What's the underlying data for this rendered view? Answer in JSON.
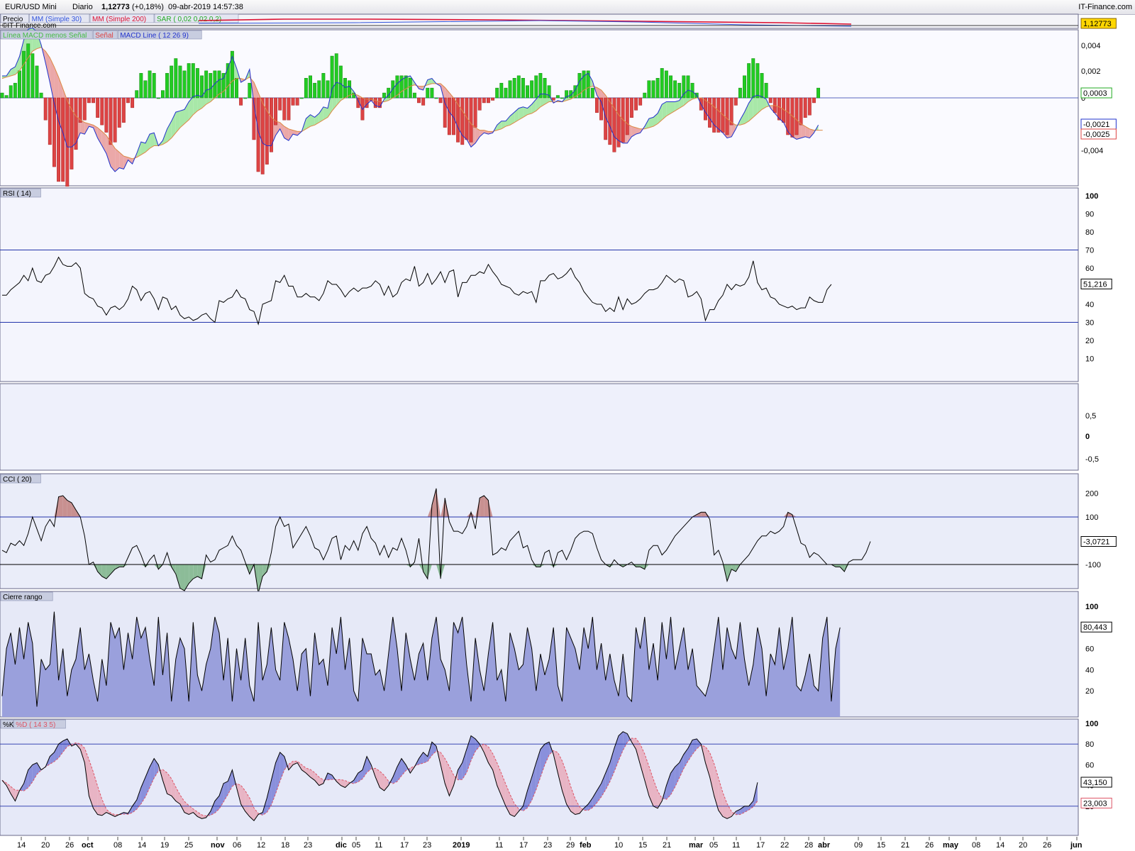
{
  "header": {
    "instrument": "EUR/USD Mini",
    "period": "Diario",
    "price": "1,12773",
    "change": "(+0,18%)",
    "datetime": "09-abr-2019 14:57:38",
    "brand": "IT-Finance.com"
  },
  "price_panel": {
    "legend": [
      {
        "text": "Precio",
        "color": "#000000"
      },
      {
        "text": "MM (Simple 30)",
        "color": "#3355dd"
      },
      {
        "text": "MM (Simple 200)",
        "color": "#dd1133"
      },
      {
        "text": "SAR ( 0,02 0,02 0,2)",
        "color": "#22aa22"
      }
    ],
    "watermark": "©IT-Finance.com",
    "last_value": "1,12773"
  },
  "colors": {
    "panel_bg": "#eef0fa",
    "grid_line": "#2233aa",
    "hist_pos": "#22cc22",
    "hist_neg": "#dd4444",
    "fill_pos": "#a8e8a8",
    "fill_neg": "#eba8a8",
    "cr_fill": "#9aa0dc",
    "k_fill_up": "#8a90dc",
    "k_fill_down": "#e8b4c4",
    "cci_fill_up": "#c89090",
    "cci_fill_down": "#8cbc98"
  },
  "chart_data": [
    {
      "type": "line",
      "title": "MACD",
      "legend": [
        "Línea MACD menos Señal",
        "Señal",
        "MACD Line ( 12 26 9)"
      ],
      "y_ticks": [
        "0,004",
        "0,002",
        "0",
        "-0,002",
        "-0,004"
      ],
      "last_values": {
        "histogram": "0,0003",
        "macd": "-0,0021",
        "signal": "-0,0025"
      },
      "macd": [
        0.0017,
        0.0017,
        0.0022,
        0.0024,
        0.0032,
        0.0045,
        0.0053,
        0.0054,
        0.0051,
        0.0041,
        0.0027,
        0.0012,
        -0.0004,
        -0.0018,
        -0.0027,
        -0.0038,
        -0.0038,
        -0.0035,
        -0.0027,
        -0.0028,
        -0.0022,
        -0.0023,
        -0.0031,
        -0.0037,
        -0.0043,
        -0.0053,
        -0.0057,
        -0.0054,
        -0.0055,
        -0.0048,
        -0.0051,
        -0.0043,
        -0.0034,
        -0.0035,
        -0.0028,
        -0.0027,
        -0.0037,
        -0.0033,
        -0.0024,
        -0.0018,
        -0.0011,
        -0.001,
        -0.0009,
        -0.0003,
        0.0001,
        0.0002,
        0.0001,
        0.0006,
        0.0007,
        0.0011,
        0.0014,
        0.0015,
        0.0023,
        0.0032,
        0.0023,
        0.0012,
        0.0014,
        0.0022,
        -0.0005,
        -0.0026,
        -0.0035,
        -0.0037,
        -0.0037,
        -0.0029,
        -0.0024,
        -0.0031,
        -0.0033,
        -0.0028,
        -0.0029,
        -0.0026,
        -0.0016,
        -0.0013,
        -0.0015,
        -0.0012,
        -0.0007,
        -0.0008,
        0.0007,
        0.0012,
        0.0011,
        0.0008,
        0.0009,
        0.0005,
        -0.0002,
        -0.0009,
        -0.0005,
        -0.0002,
        -0.0006,
        -0.0007,
        -0.0001,
        0.0002,
        0.0007,
        0.0011,
        0.0014,
        0.0016,
        0.0017,
        0.0012,
        0.0007,
        0.0006,
        0.0014,
        0.0015,
        0.0011,
        0.0009,
        -0.0004,
        -0.0011,
        -0.0015,
        -0.0023,
        -0.0029,
        -0.0032,
        -0.0038,
        -0.0035,
        -0.003,
        -0.0027,
        -0.0028,
        -0.0027,
        -0.0021,
        -0.0018,
        -0.0018,
        -0.0014,
        -0.0011,
        -0.0008,
        -0.0007,
        -0.0008,
        -0.0005,
        -0.0001,
        0.0003,
        0.0003,
        0.0002,
        -0.0004,
        -0.0002,
        -0.0003,
        0.0001,
        0.0002,
        0.0006,
        0.0013,
        0.0017,
        0.0019,
        0.0013,
        0.0002,
        -0.0003,
        -0.0015,
        -0.0022,
        -0.003,
        -0.0033,
        -0.0035,
        -0.0035,
        -0.003,
        -0.0028,
        -0.0027,
        -0.0022,
        -0.0016,
        -0.0015,
        -0.0012,
        -0.0005,
        -0.0003,
        -0.0003,
        -0.0003,
        -0.0002,
        0.0003,
        0.0006,
        0.0005,
        0.0002,
        -0.0005,
        -0.0011,
        -0.0016,
        -0.0021,
        -0.0024,
        -0.0027,
        -0.0031,
        -0.003,
        -0.0024,
        -0.0017,
        -0.0011,
        -0.0004,
        0.0001,
        0.0002,
        0.0001,
        -0.0001,
        -0.0008,
        -0.0012,
        -0.0016,
        -0.0019,
        -0.0026,
        -0.003,
        -0.0032,
        -0.0031,
        -0.003,
        -0.0031,
        -0.0027,
        -0.0021
      ],
      "signal": [
        0.0015,
        0.0016,
        0.0017,
        0.0018,
        0.0021,
        0.0026,
        0.0031,
        0.0036,
        0.0038,
        0.0039,
        0.0036,
        0.0031,
        0.0024,
        0.0016,
        0.0007,
        -0.0002,
        -0.0009,
        -0.0014,
        -0.0017,
        -0.0019,
        -0.002,
        -0.0021,
        -0.0023,
        -0.0026,
        -0.0029,
        -0.0034,
        -0.0039,
        -0.0042,
        -0.0045,
        -0.0046,
        -0.0047,
        -0.0046,
        -0.0044,
        -0.0042,
        -0.0039,
        -0.0037,
        -0.0037,
        -0.0036,
        -0.0034,
        -0.0031,
        -0.0027,
        -0.0023,
        -0.002,
        -0.0017,
        -0.0013,
        -0.001,
        -0.0008,
        -0.0005,
        -0.0003,
        -0.0,
        0.0003,
        0.0005,
        0.0009,
        0.0013,
        0.0015,
        0.0015,
        0.0014,
        0.0016,
        0.0012,
        0.0004,
        -0.0004,
        -0.001,
        -0.0015,
        -0.0018,
        -0.0019,
        -0.0022,
        -0.0024,
        -0.0025,
        -0.0026,
        -0.0026,
        -0.0024,
        -0.0022,
        -0.0021,
        -0.0019,
        -0.0017,
        -0.0015,
        -0.001,
        -0.0006,
        -0.0002,
        0.0,
        0.0002,
        0.0003,
        0.0002,
        0.0,
        -0.0001,
        -0.0001,
        -0.0002,
        -0.0003,
        -0.0003,
        -0.0002,
        0.0,
        0.0002,
        0.0005,
        0.0007,
        0.0009,
        0.001,
        0.0009,
        0.0009,
        0.001,
        0.0011,
        0.0011,
        0.0011,
        0.0008,
        0.0004,
        0.0,
        -0.0005,
        -0.001,
        -0.0015,
        -0.002,
        -0.0023,
        -0.0025,
        -0.0025,
        -0.0026,
        -0.0026,
        -0.0025,
        -0.0024,
        -0.0022,
        -0.0021,
        -0.0019,
        -0.0017,
        -0.0015,
        -0.0013,
        -0.0012,
        -0.001,
        -0.0007,
        -0.0005,
        -0.0003,
        -0.0003,
        -0.0003,
        -0.0003,
        -0.0002,
        -0.0001,
        0.0001,
        0.0003,
        0.0006,
        0.0008,
        0.0009,
        0.0008,
        0.0006,
        0.0002,
        -0.0003,
        -0.0008,
        -0.0013,
        -0.0017,
        -0.002,
        -0.0022,
        -0.0023,
        -0.0024,
        -0.0024,
        -0.0023,
        -0.0022,
        -0.002,
        -0.0017,
        -0.0014,
        -0.0012,
        -0.001,
        -0.0008,
        -0.0006,
        -0.0003,
        -0.0001,
        0.0,
        -0.0,
        -0.0002,
        -0.0004,
        -0.0007,
        -0.001,
        -0.0013,
        -0.0016,
        -0.0019,
        -0.0021,
        -0.0021,
        -0.002,
        -0.0018,
        -0.0015,
        -0.0012,
        -0.0009,
        -0.0007,
        -0.0006,
        -0.0006,
        -0.0007,
        -0.0009,
        -0.0011,
        -0.0014,
        -0.0017,
        -0.002,
        -0.0022,
        -0.0024,
        -0.0025,
        -0.0025,
        -0.0025
      ]
    },
    {
      "type": "line",
      "title": "RSI ( 14)",
      "y_ticks": [
        "100",
        "90",
        "80",
        "70",
        "60",
        "50",
        "40",
        "30",
        "20",
        "10"
      ],
      "bands": [
        70,
        30
      ],
      "last_value": "51,216",
      "values": [
        45,
        45,
        48,
        50,
        52,
        56,
        53,
        60,
        53,
        52,
        56,
        57,
        61,
        66,
        62,
        61,
        61,
        63,
        60,
        46,
        44,
        43,
        39,
        38,
        34,
        38,
        39,
        37,
        39,
        43,
        50,
        48,
        42,
        46,
        47,
        43,
        37,
        44,
        43,
        37,
        39,
        34,
        32,
        33,
        31,
        32,
        34,
        35,
        32,
        30,
        42,
        41,
        43,
        44,
        48,
        44,
        43,
        37,
        36,
        29,
        40,
        41,
        42,
        53,
        52,
        56,
        50,
        50,
        44,
        44,
        46,
        44,
        44,
        42,
        46,
        53,
        51,
        51,
        48,
        44,
        47,
        49,
        47,
        49,
        49,
        50,
        53,
        51,
        45,
        50,
        44,
        46,
        52,
        54,
        53,
        61,
        50,
        52,
        57,
        51,
        54,
        58,
        52,
        58,
        59,
        44,
        52,
        52,
        56,
        56,
        58,
        57,
        62,
        58,
        55,
        51,
        50,
        49,
        46,
        45,
        47,
        46,
        47,
        41,
        53,
        53,
        56,
        57,
        54,
        55,
        57,
        60,
        55,
        52,
        47,
        44,
        41,
        40,
        40,
        36,
        38,
        36,
        44,
        37,
        43,
        40,
        41,
        43,
        46,
        48,
        48,
        49,
        52,
        56,
        54,
        52,
        54,
        53,
        44,
        45,
        47,
        43,
        31,
        37,
        37,
        42,
        45,
        51,
        48,
        51,
        50,
        51,
        55,
        64,
        52,
        48,
        49,
        44,
        43,
        40,
        39,
        38,
        39,
        37,
        38,
        38,
        44,
        42,
        41,
        41,
        48,
        51
      ]
    },
    {
      "type": "line",
      "title": "",
      "y_ticks": [
        "0,5",
        "0",
        "-0,5"
      ],
      "values": []
    },
    {
      "type": "line",
      "title": "CCI ( 20)",
      "y_ticks": [
        "200",
        "100",
        "-100"
      ],
      "bands": [
        100,
        -100
      ],
      "last_value": "-3,0721",
      "values": [
        -40,
        -50,
        -10,
        -20,
        0,
        -20,
        30,
        100,
        50,
        0,
        60,
        90,
        60,
        185,
        190,
        170,
        160,
        130,
        100,
        20,
        -100,
        -90,
        -130,
        -150,
        -160,
        -140,
        -120,
        -110,
        -110,
        -70,
        -30,
        -20,
        -60,
        -110,
        -80,
        -60,
        -120,
        -100,
        -50,
        -110,
        -140,
        -200,
        -210,
        -180,
        -160,
        -150,
        -160,
        -60,
        -90,
        -80,
        -40,
        -30,
        -20,
        20,
        -20,
        -40,
        -90,
        -140,
        -100,
        -220,
        -150,
        -130,
        -50,
        60,
        100,
        60,
        70,
        -30,
        0,
        30,
        60,
        20,
        -30,
        -40,
        -80,
        -40,
        10,
        20,
        -80,
        -20,
        -40,
        0,
        -40,
        30,
        60,
        10,
        -10,
        -60,
        -20,
        -70,
        -30,
        -40,
        10,
        -40,
        -110,
        -90,
        10,
        -130,
        -160,
        150,
        220,
        -160,
        180,
        80,
        40,
        40,
        30,
        60,
        120,
        50,
        180,
        190,
        170,
        -60,
        -50,
        -30,
        -40,
        0,
        20,
        40,
        -30,
        -20,
        -80,
        -110,
        -110,
        -50,
        -40,
        -110,
        -50,
        -40,
        -80,
        -40,
        10,
        30,
        40,
        40,
        30,
        -30,
        -80,
        -100,
        -110,
        -80,
        -100,
        -110,
        -100,
        -90,
        -110,
        -110,
        -120,
        -40,
        -20,
        -20,
        -60,
        -40,
        -10,
        20,
        40,
        60,
        80,
        100,
        110,
        120,
        120,
        90,
        -60,
        -40,
        -90,
        -170,
        -120,
        -130,
        -100,
        -80,
        -60,
        -30,
        0,
        20,
        20,
        40,
        30,
        40,
        60,
        120,
        110,
        50,
        -10,
        -20,
        -70,
        -50,
        -60,
        -80,
        -100,
        -100,
        -110,
        -110,
        -130,
        -90,
        -80,
        -80,
        -80,
        -50,
        -3
      ]
    },
    {
      "type": "area",
      "title": "Cierre rango",
      "y_ticks": [
        "100",
        "80",
        "60",
        "40",
        "20"
      ],
      "last_value": "80,443",
      "values": [
        15,
        60,
        75,
        45,
        80,
        50,
        85,
        65,
        5,
        50,
        40,
        45,
        95,
        30,
        60,
        15,
        40,
        50,
        80,
        40,
        55,
        30,
        10,
        50,
        25,
        85,
        70,
        80,
        40,
        75,
        50,
        90,
        70,
        80,
        50,
        25,
        90,
        35,
        75,
        10,
        50,
        70,
        60,
        10,
        85,
        35,
        20,
        45,
        60,
        90,
        75,
        30,
        70,
        10,
        60,
        30,
        70,
        25,
        10,
        85,
        30,
        45,
        80,
        40,
        30,
        85,
        70,
        50,
        20,
        55,
        60,
        15,
        75,
        45,
        50,
        25,
        80,
        55,
        90,
        40,
        70,
        20,
        10,
        70,
        55,
        55,
        35,
        40,
        20,
        55,
        90,
        60,
        20,
        75,
        50,
        30,
        55,
        65,
        30,
        70,
        90,
        50,
        40,
        20,
        85,
        75,
        90,
        45,
        10,
        70,
        40,
        20,
        55,
        85,
        30,
        40,
        10,
        75,
        60,
        40,
        45,
        80,
        60,
        20,
        55,
        35,
        50,
        80,
        25,
        10,
        80,
        70,
        60,
        40,
        80,
        60,
        90,
        40,
        65,
        30,
        55,
        30,
        15,
        55,
        15,
        10,
        80,
        60,
        90,
        40,
        65,
        30,
        85,
        50,
        90,
        40,
        60,
        80,
        40,
        60,
        25,
        20,
        15,
        30,
        60,
        90,
        40,
        80,
        60,
        50,
        85,
        50,
        25,
        45,
        80,
        60,
        15,
        55,
        45,
        80,
        40,
        60,
        90,
        25,
        20,
        35,
        55,
        25,
        20,
        70,
        90,
        10,
        60,
        80
      ]
    },
    {
      "type": "line",
      "title": "%K / %D ( 14 3 5)",
      "legend": [
        "%K",
        "%D ( 14 3 5)"
      ],
      "y_ticks": [
        "100",
        "80",
        "60",
        "40",
        "20"
      ],
      "bands": [
        80,
        20
      ],
      "last_values": {
        "k": "43,150",
        "d": "23,003"
      },
      "k": [
        45,
        40,
        32,
        25,
        35,
        42,
        55,
        60,
        62,
        55,
        58,
        68,
        72,
        80,
        83,
        85,
        78,
        80,
        75,
        62,
        30,
        18,
        12,
        11,
        14,
        12,
        10,
        12,
        14,
        13,
        20,
        26,
        38,
        48,
        58,
        66,
        60,
        45,
        32,
        30,
        25,
        22,
        14,
        12,
        14,
        10,
        8,
        9,
        15,
        25,
        30,
        42,
        44,
        55,
        38,
        22,
        15,
        10,
        6,
        12,
        14,
        28,
        45,
        62,
        72,
        68,
        55,
        60,
        62,
        55,
        52,
        48,
        45,
        40,
        42,
        52,
        50,
        44,
        40,
        38,
        42,
        45,
        52,
        55,
        68,
        60,
        48,
        38,
        35,
        40,
        48,
        58,
        66,
        60,
        52,
        58,
        66,
        72,
        68,
        82,
        78,
        60,
        42,
        30,
        40,
        55,
        62,
        75,
        88,
        85,
        80,
        72,
        62,
        55,
        40,
        30,
        20,
        12,
        10,
        15,
        20,
        35,
        48,
        62,
        75,
        80,
        82,
        70,
        52,
        35,
        22,
        15,
        12,
        13,
        18,
        22,
        28,
        35,
        42,
        52,
        62,
        76,
        88,
        92,
        90,
        82,
        75,
        60,
        45,
        30,
        20,
        18,
        25,
        40,
        52,
        58,
        62,
        70,
        76,
        84,
        85,
        80,
        62,
        48,
        30,
        16,
        10,
        8,
        10,
        15,
        17,
        20,
        20,
        25,
        43
      ]
    }
  ],
  "x_axis": {
    "labels": [
      "14",
      "20",
      "26",
      "oct",
      "08",
      "14",
      "19",
      "25",
      "nov",
      "06",
      "12",
      "18",
      "23",
      "dic",
      "05",
      "11",
      "17",
      "23",
      "2019",
      "11",
      "17",
      "23",
      "29",
      "feb",
      "10",
      "15",
      "21",
      "mar",
      "05",
      "11",
      "17",
      "22",
      "28",
      "abr",
      "09",
      "15",
      "21",
      "26",
      "may",
      "08",
      "14",
      "20",
      "26",
      "jun"
    ]
  }
}
